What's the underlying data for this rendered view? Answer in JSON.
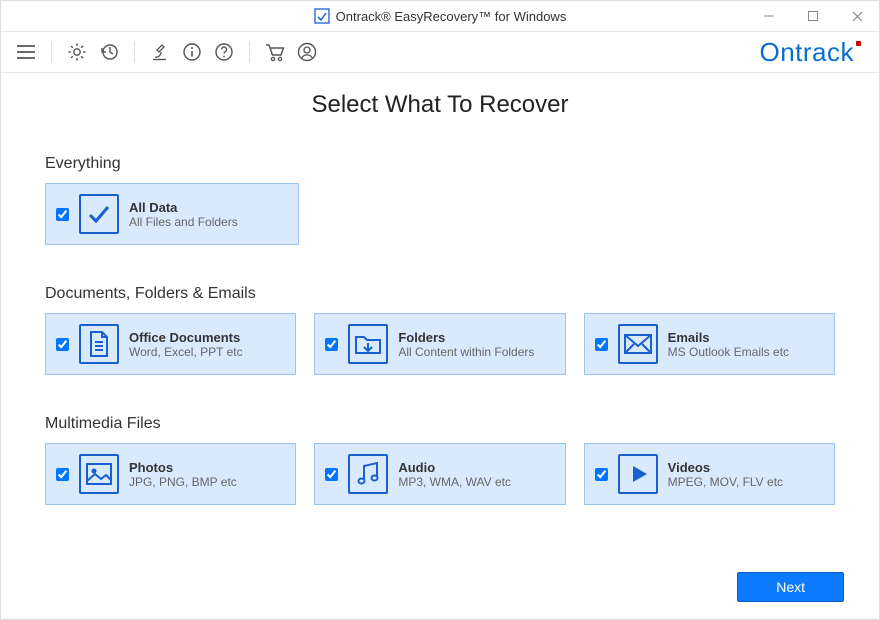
{
  "window": {
    "title": "Ontrack® EasyRecovery™ for Windows"
  },
  "brand": "Ontrack",
  "page": {
    "heading": "Select What To Recover"
  },
  "sections": {
    "everything": {
      "title": "Everything",
      "item": {
        "name": "All Data",
        "sub": "All Files and Folders"
      }
    },
    "docs": {
      "title": "Documents, Folders & Emails",
      "items": [
        {
          "name": "Office Documents",
          "sub": "Word, Excel, PPT etc"
        },
        {
          "name": "Folders",
          "sub": "All Content within Folders"
        },
        {
          "name": "Emails",
          "sub": "MS Outlook Emails etc"
        }
      ]
    },
    "media": {
      "title": "Multimedia Files",
      "items": [
        {
          "name": "Photos",
          "sub": "JPG, PNG, BMP etc"
        },
        {
          "name": "Audio",
          "sub": "MP3, WMA, WAV etc"
        },
        {
          "name": "Videos",
          "sub": "MPEG, MOV, FLV etc"
        }
      ]
    }
  },
  "footer": {
    "next_label": "Next"
  }
}
